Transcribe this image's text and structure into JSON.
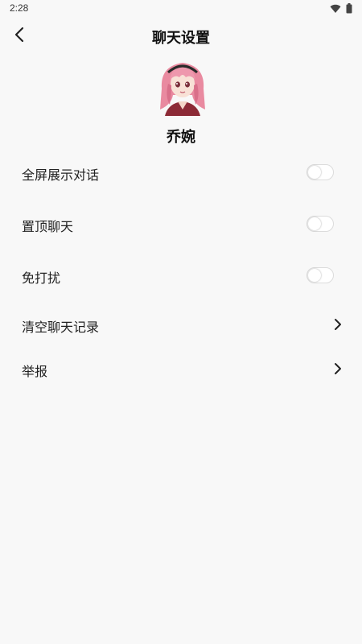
{
  "status_bar": {
    "time": "2:28",
    "icons": [
      "wifi-icon",
      "battery-icon"
    ]
  },
  "header": {
    "title": "聊天设置",
    "back_icon": "back-arrow-icon"
  },
  "profile": {
    "name": "乔婉",
    "avatar": "anime-girl-avatar"
  },
  "settings": [
    {
      "label": "全屏展示对话",
      "control": "toggle",
      "on": false
    },
    {
      "label": "置顶聊天",
      "control": "toggle",
      "on": false
    },
    {
      "label": "免打扰",
      "control": "toggle",
      "on": false
    },
    {
      "label": "清空聊天记录",
      "control": "chevron"
    },
    {
      "label": "举报",
      "control": "chevron"
    }
  ],
  "colors": {
    "background": "#f8f8f8",
    "text": "#222222",
    "toggle_off": "#ffffff",
    "avatar_hair": "#e98aa0"
  }
}
